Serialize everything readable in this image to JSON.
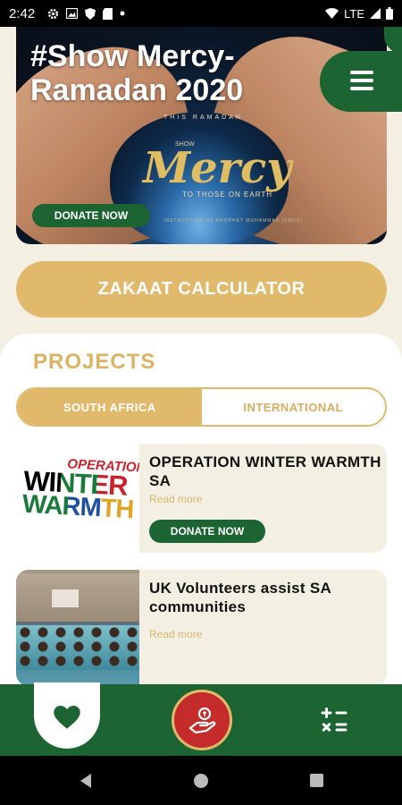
{
  "status": {
    "time": "2:42",
    "network": "LTE"
  },
  "hero": {
    "title": "#Show Mercy-Ramadan 2020",
    "caption_top": "THIS RAMADAN",
    "caption_show": "SHOW",
    "mercy_word": "Mercy",
    "mercy_sub": "TO THOSE ON EARTH",
    "mercy_foot": "INSTRUCTION OF PROPHET MUHAMMAD (PBUH)",
    "donate_label": "DONATE NOW"
  },
  "zakaat_label": "ZAKAAT CALCULATOR",
  "projects": {
    "title": "PROJECTS",
    "tabs": [
      {
        "label": "SOUTH AFRICA",
        "active": true
      },
      {
        "label": "INTERNATIONAL",
        "active": false
      }
    ],
    "items": [
      {
        "title": "OPERATION WINTER WARMTH SA",
        "read_more": "Read more",
        "donate_label": "DONATE NOW",
        "thumb": {
          "line1": "OPERATION",
          "line2": "WINTER",
          "line3": "WARMTH"
        }
      },
      {
        "title": "UK Volunteers assist SA communities",
        "read_more": "Read more"
      }
    ]
  },
  "colors": {
    "brand_green": "#1d6433",
    "gold": "#e1b96b",
    "red": "#c42b2b",
    "cream": "#f4efe3"
  },
  "icons": {
    "menu": "hamburger-menu-icon",
    "home": "heart-icon",
    "donate": "donate-hand-icon",
    "calculator": "calculator-icon"
  }
}
